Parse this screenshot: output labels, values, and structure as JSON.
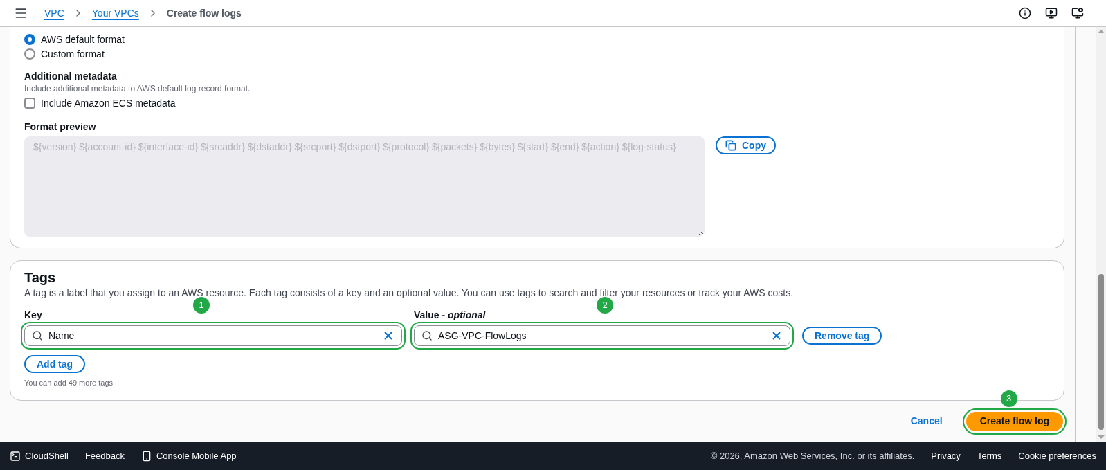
{
  "header": {
    "breadcrumbs": [
      {
        "label": "VPC",
        "link": true
      },
      {
        "label": "Your VPCs",
        "link": true
      },
      {
        "label": "Create flow logs",
        "link": false
      }
    ]
  },
  "format": {
    "options": [
      {
        "label": "AWS default format",
        "selected": true
      },
      {
        "label": "Custom format",
        "selected": false
      }
    ],
    "metadata": {
      "title": "Additional metadata",
      "description": "Include additional metadata to AWS default log record format.",
      "checkbox": {
        "label": "Include Amazon ECS metadata",
        "checked": false
      }
    },
    "preview": {
      "label": "Format preview",
      "value": "${version} ${account-id} ${interface-id} ${srcaddr} ${dstaddr} ${srcport} ${dstport} ${protocol} ${packets} ${bytes} ${start} ${end} ${action} ${log-status}",
      "copy_button": "Copy"
    }
  },
  "tags": {
    "title": "Tags",
    "description": "A tag is a label that you assign to an AWS resource. Each tag consists of a key and an optional value. You can use tags to search and filter your resources or track your AWS costs.",
    "key": {
      "label": "Key",
      "value": "Name",
      "step": "1"
    },
    "value": {
      "label": "Value - ",
      "label_suffix": "optional",
      "value": "ASG-VPC-FlowLogs",
      "step": "2"
    },
    "remove_button": "Remove tag",
    "add_button": "Add tag",
    "hint": "You can add 49 more tags"
  },
  "actions": {
    "cancel": "Cancel",
    "submit": {
      "label": "Create flow log",
      "step": "3"
    }
  },
  "footer": {
    "left": [
      {
        "label": "CloudShell",
        "kind": "terminal"
      },
      {
        "label": "Feedback",
        "kind": "plain"
      },
      {
        "label": "Console Mobile App",
        "kind": "phone"
      }
    ],
    "copyright": "© 2026, Amazon Web Services, Inc. or its affiliates.",
    "links": [
      "Privacy",
      "Terms",
      "Cookie preferences"
    ]
  }
}
